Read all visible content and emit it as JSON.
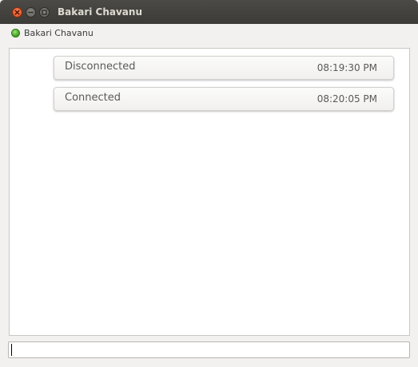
{
  "window": {
    "title": "Bakari Chavanu",
    "buttons": {
      "close": "close-icon",
      "minimize": "minimize-icon",
      "maximize": "maximize-icon"
    },
    "colors": {
      "close": "#e0461a",
      "titlebar": "#3c3b37"
    }
  },
  "contact": {
    "name": "Bakari Chavanu",
    "status_icon": "status-online-icon",
    "status_color": "#3c9a1e"
  },
  "messages": [
    {
      "text": "Disconnected",
      "time": "08:19:30 PM"
    },
    {
      "text": "Connected",
      "time": "08:20:05 PM"
    }
  ],
  "input": {
    "value": "",
    "placeholder": ""
  }
}
